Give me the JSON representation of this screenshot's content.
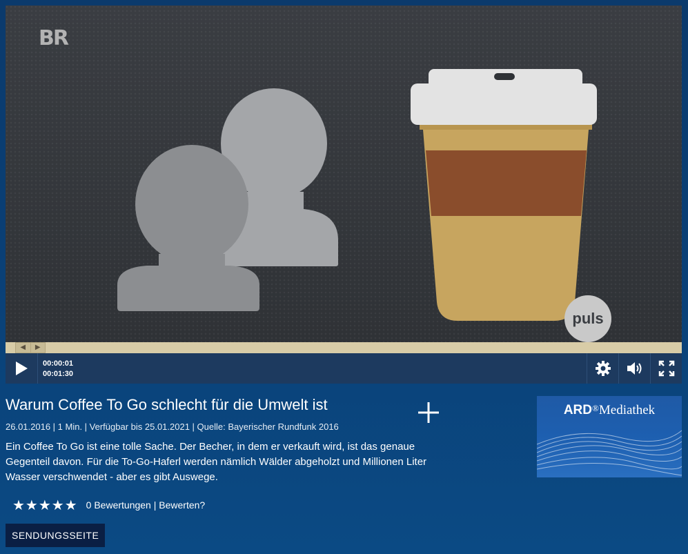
{
  "player": {
    "channel_logo": "BR",
    "watermark": "puls",
    "current_time": "00:00:01",
    "duration": "00:01:30",
    "progress_fraction": 0.01,
    "icons": {
      "play": "play-icon",
      "settings": "gear-icon",
      "volume": "volume-icon",
      "fullscreen": "fullscreen-icon",
      "handle_left": "arrow-left-icon",
      "handle_right": "arrow-right-icon"
    },
    "colors": {
      "progress_bar": "#d8cca7",
      "control_bar": "#1d3a5f"
    }
  },
  "video_info": {
    "title": "Warum Coffee To Go schlecht für die Umwelt ist",
    "meta": "26.01.2016 | 1 Min. | Verfügbar bis 25.01.2021 | Quelle: Bayerischer Rundfunk 2016",
    "description": "Ein Coffee To Go ist eine tolle Sache. Der Becher, in dem er verkauft wird, ist das genaue Gegenteil davon. Für die To-Go-Haferl werden nämlich Wälder abgeholzt und Millionen Liter Wasser verschwendet - aber es gibt Auswege.",
    "add_icon": "plus-icon"
  },
  "rating": {
    "stars": "★★★★★",
    "count_text": "0 Bewertungen",
    "separator": "|",
    "rate_link": "Bewerten?"
  },
  "show_button": "SENDUNGSSEITE",
  "brand": {
    "ard": "ARD",
    "registered": "®",
    "mediathek": "Mediathek",
    "accent": "#1f5aa6"
  }
}
